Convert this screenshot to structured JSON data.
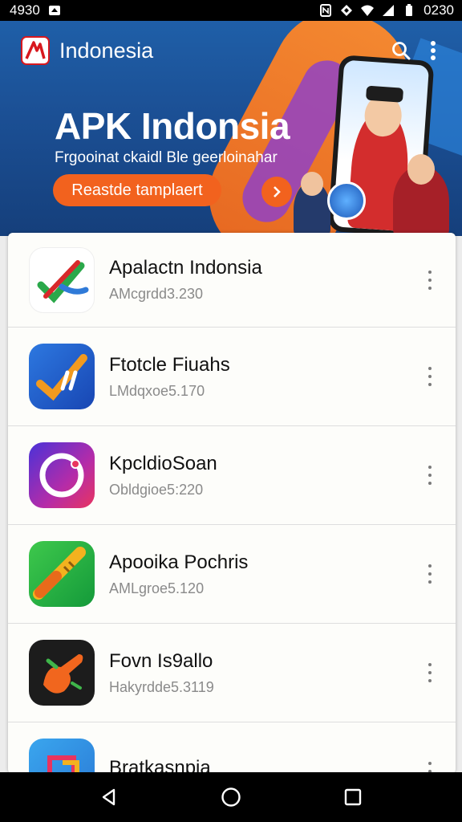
{
  "status_bar": {
    "time_left": "4930",
    "time_right": "0230",
    "icons": [
      "notification-icon",
      "nfc-icon",
      "location-icon",
      "wifi-icon",
      "signal-icon",
      "battery-icon"
    ]
  },
  "app_bar": {
    "title": "Indonesia",
    "icons": [
      "app-logo-icon",
      "search-icon",
      "more-vert-icon"
    ]
  },
  "hero": {
    "title": "APK Indonsia",
    "subtitle": "Frgooinat ckaidl Ble geerloinahar",
    "cta_label": "Reastde tamplaert",
    "arrow_icon": "chevron-right-icon"
  },
  "apps": [
    {
      "title": "Apalactn Indonsia",
      "subtitle": "AMcgrdd3.230",
      "icon": "check-swoosh-app-icon"
    },
    {
      "title": "Ftotcle Fiuahs",
      "subtitle": "LMdqxoe5.170",
      "icon": "blue-check-app-icon"
    },
    {
      "title": "KpcldioSoan",
      "subtitle": "Obldgioe5:220",
      "icon": "camera-ring-app-icon"
    },
    {
      "title": "Apooika Pochris",
      "subtitle": "AMLgroe5.120",
      "icon": "green-tool-app-icon"
    },
    {
      "title": "Fovn Is9allo",
      "subtitle": "Hakyrdde5.3119",
      "icon": "orange-hand-app-icon"
    },
    {
      "title": "Bratkasnpia",
      "subtitle": "",
      "icon": "blue-shapes-app-icon"
    }
  ],
  "nav_bar": {
    "icons": [
      "back-icon",
      "home-icon",
      "recents-icon"
    ]
  },
  "colors": {
    "hero_blue": "#1b4f94",
    "accent_orange": "#f2621e",
    "logo_red": "#d8181e"
  }
}
